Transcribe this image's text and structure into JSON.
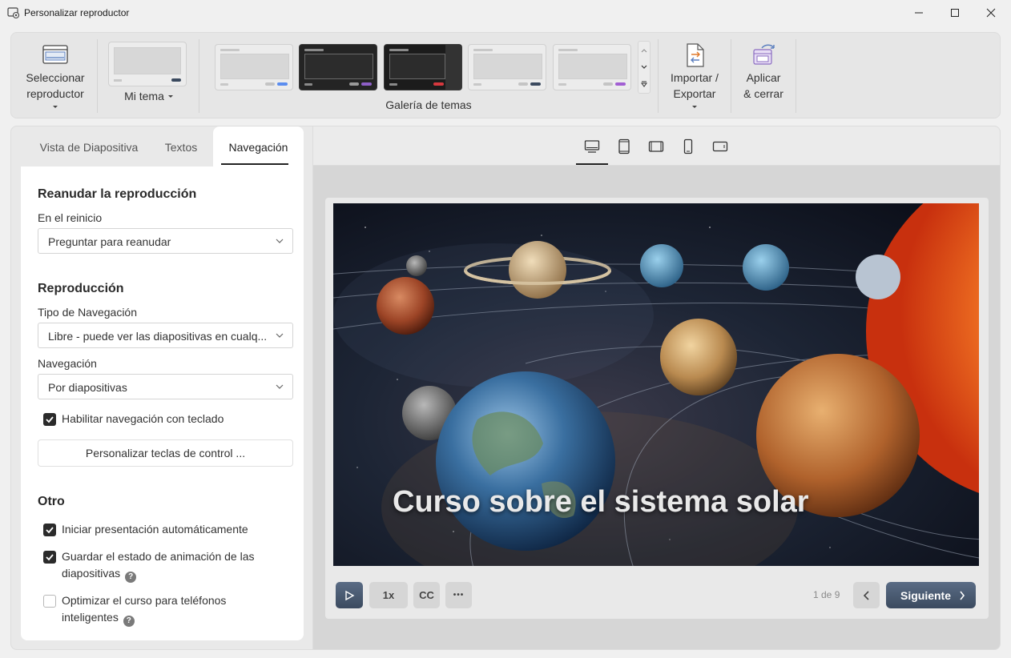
{
  "window": {
    "title": "Personalizar reproductor",
    "minimize": "—",
    "maximize": "☐",
    "close": "✕"
  },
  "ribbon": {
    "select_player": {
      "line1": "Seleccionar",
      "line2": "reproductor"
    },
    "my_theme": "Mi tema",
    "gallery_label": "Galería de temas",
    "import_export": {
      "line1": "Importar /",
      "line2": "Exportar"
    },
    "apply_close": {
      "line1": "Aplicar",
      "line2": "& cerrar"
    },
    "theme_accents": [
      "#5b8def",
      "#8e5fc7",
      "#d6383e",
      "#3b4a5f",
      "#a25fd3"
    ]
  },
  "tabs": [
    {
      "label": "Vista de Diapositiva"
    },
    {
      "label": "Textos"
    },
    {
      "label": "Navegación"
    }
  ],
  "form": {
    "resume": {
      "title": "Reanudar la reproducción",
      "on_restart_label": "En el reinicio",
      "on_restart_value": "Preguntar para reanudar"
    },
    "playback": {
      "title": "Reproducción",
      "nav_type_label": "Tipo de Navegación",
      "nav_type_value": "Libre - puede ver las diapositivas en cualq...",
      "nav_label": "Navegación",
      "nav_value": "Por diapositivas",
      "keyboard_nav": "Habilitar navegación con teclado",
      "customize_keys": "Personalizar teclas de control ..."
    },
    "other": {
      "title": "Otro",
      "autostart": "Iniciar presentación automáticamente",
      "save_anim_line1": "Guardar el estado de animación de las",
      "save_anim_line2": "diapositivas",
      "optimize_line1": "Optimizar el curso para teléfonos",
      "optimize_line2": "inteligentes",
      "help": "?"
    }
  },
  "player": {
    "slide_title": "Curso sobre el sistema solar",
    "speed": "1x",
    "cc": "CC",
    "more": "•••",
    "page": "1 de 9",
    "next": "Siguiente"
  }
}
